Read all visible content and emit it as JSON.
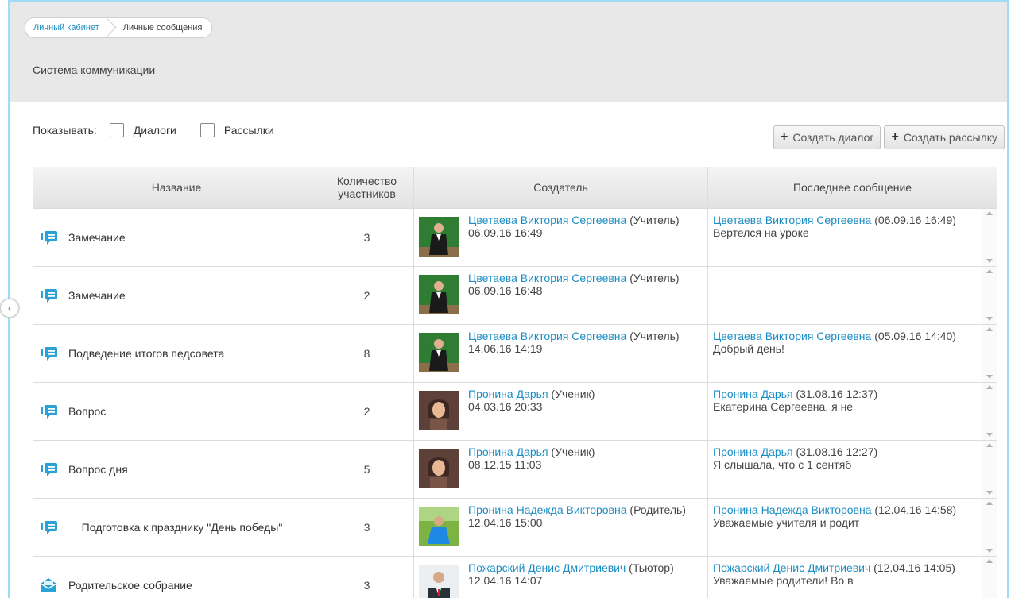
{
  "breadcrumb": {
    "home": "Личный кабинет",
    "current": "Личные сообщения"
  },
  "page_title": "Система коммуникации",
  "filters": {
    "label": "Показывать:",
    "dialogs": "Диалоги",
    "mailings": "Рассылки"
  },
  "buttons": {
    "create_dialog": "Создать диалог",
    "create_mailing": "Создать рассылку"
  },
  "side_toggle": "‹",
  "table": {
    "headers": {
      "name": "Название",
      "count": "Количество участников",
      "creator": "Создатель",
      "last": "Последнее сообщение"
    },
    "rows": [
      {
        "icon": "dialog-icon",
        "title": "Замечание",
        "count": "3",
        "creator_name": "Цветаева Виктория Сергеевна",
        "creator_role": "(Учитель)",
        "creator_date": "06.09.16 16:49",
        "avatar": "teacher-avatar",
        "last_name": "Цветаева Виктория Сергеевна",
        "last_date": "(06.09.16 16:49)",
        "last_text": "Вертелся на уроке"
      },
      {
        "icon": "dialog-icon",
        "title": "Замечание",
        "count": "2",
        "creator_name": "Цветаева Виктория Сергеевна",
        "creator_role": "(Учитель)",
        "creator_date": "06.09.16 16:48",
        "avatar": "teacher-avatar",
        "last_name": "",
        "last_date": "",
        "last_text": ""
      },
      {
        "icon": "dialog-icon",
        "title": "Подведение итогов педсовета",
        "count": "8",
        "creator_name": "Цветаева Виктория Сергеевна",
        "creator_role": "(Учитель)",
        "creator_date": "14.06.16 14:19",
        "avatar": "teacher-avatar",
        "last_name": "Цветаева Виктория Сергеевна",
        "last_date": "(05.09.16 14:40)",
        "last_text": "Добрый день!"
      },
      {
        "icon": "dialog-icon",
        "title": "Вопрос",
        "count": "2",
        "creator_name": "Пронина Дарья",
        "creator_role": "(Ученик)",
        "creator_date": "04.03.16 20:33",
        "avatar": "student-avatar",
        "last_name": "Пронина Дарья",
        "last_date": "(31.08.16 12:37)",
        "last_text": "Екатерина Сергеевна, я не"
      },
      {
        "icon": "dialog-icon",
        "title": "Вопрос дня",
        "count": "5",
        "creator_name": "Пронина Дарья",
        "creator_role": "(Ученик)",
        "creator_date": "08.12.15 11:03",
        "avatar": "student-avatar",
        "last_name": "Пронина Дарья",
        "last_date": "(31.08.16 12:27)",
        "last_text": "Я слышала, что с 1 сентяб"
      },
      {
        "icon": "dialog-icon",
        "title": "Подготовка к празднику \"День победы\"",
        "count": "3",
        "creator_name": "Пронина Надежда Викторовна",
        "creator_role": "(Родитель)",
        "creator_date": "12.04.16 15:00",
        "avatar": "parent-avatar",
        "last_name": "Пронина Надежда Викторовна",
        "last_date": "(12.04.16 14:58)",
        "last_text": "Уважаемые учителя и родит"
      },
      {
        "icon": "mailing-icon",
        "title": "Родительское собрание",
        "count": "3",
        "creator_name": "Пожарский Денис Дмитриевич",
        "creator_role": "(Тьютор)",
        "creator_date": "12.04.16 14:07",
        "avatar": "tutor-avatar",
        "last_name": "Пожарский Денис Дмитриевич",
        "last_date": "(12.04.16 14:05)",
        "last_text": "Уважаемые родители! Во в"
      }
    ]
  }
}
